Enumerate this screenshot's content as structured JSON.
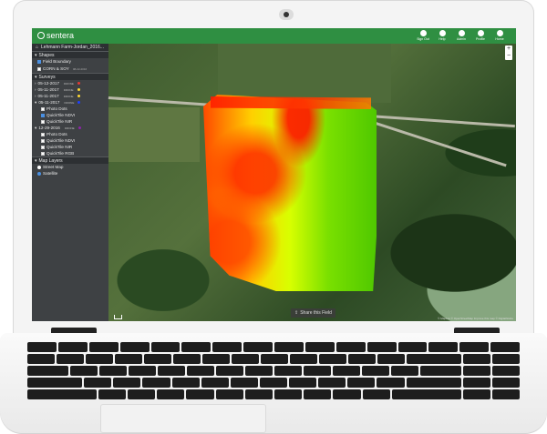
{
  "app": {
    "brand": "sentera",
    "breadcrumb": "Lehmann Farm-Jordan_2016..."
  },
  "topnav": [
    {
      "label": "Sign Out",
      "icon": "sign-out-icon"
    },
    {
      "label": "Help",
      "icon": "help-icon"
    },
    {
      "label": "Admin",
      "icon": "gear-icon"
    },
    {
      "label": "Profile",
      "icon": "user-icon"
    },
    {
      "label": "Home",
      "icon": "home-icon"
    }
  ],
  "sidebar": {
    "shapes_title": "Shapes",
    "field_boundary": "Field Boundary",
    "corn_soy": "CORN & SOY",
    "corn_soy_date": "08-22-2016",
    "surveys_title": "Surveys",
    "surveys": [
      {
        "date": "05-12-2017",
        "tag": "DRONE",
        "color": "#e53935"
      },
      {
        "date": "05-11-2017",
        "tag": "DRONE",
        "color": "#fdd835"
      },
      {
        "date": "05-11-2017",
        "tag": "DRONE",
        "color": "#fdd835"
      },
      {
        "date": "05-11-2017",
        "tag": "DRONE",
        "color": "#1e40ff"
      }
    ],
    "survey_items_a": [
      "Photo Dots",
      "QuickTile NDVI",
      "QuickTile NIR"
    ],
    "survey_b": {
      "date": "12-29-2016",
      "tag": "DRONE",
      "color": "#8e24aa"
    },
    "survey_items_b": [
      "Photo Dots",
      "QuickTile NDVI",
      "QuickTile NIR",
      "QuickTile RGB"
    ],
    "layers_title": "Map Layers",
    "layers": [
      "Street Map",
      "Satellite"
    ]
  },
  "map": {
    "share_label": "Share this Field",
    "zoom_in": "+",
    "zoom_out": "−",
    "credit": "© Mapbox © OpenStreetMap Improve this map © DigitalGlobe"
  }
}
